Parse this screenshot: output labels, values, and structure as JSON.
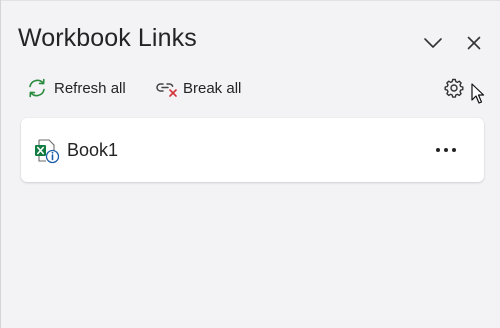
{
  "pane": {
    "title": "Workbook Links",
    "collapse_icon": "chevron-down-icon",
    "close_icon": "close-icon"
  },
  "toolbar": {
    "refresh_all_label": "Refresh all",
    "refresh_icon": "refresh-icon",
    "break_all_label": "Break all",
    "break_icon": "break-link-icon",
    "settings_icon": "gear-icon"
  },
  "links": [
    {
      "name": "Book1",
      "icon": "excel-file-info-icon",
      "more_icon": "more-options-icon"
    }
  ],
  "colors": {
    "background": "#f3f2f5",
    "card": "#ffffff",
    "text": "#242424",
    "refresh_green": "#2a8a3e",
    "break_red": "#d13438",
    "excel_green": "#107c41",
    "info_blue": "#1f5fa8"
  }
}
